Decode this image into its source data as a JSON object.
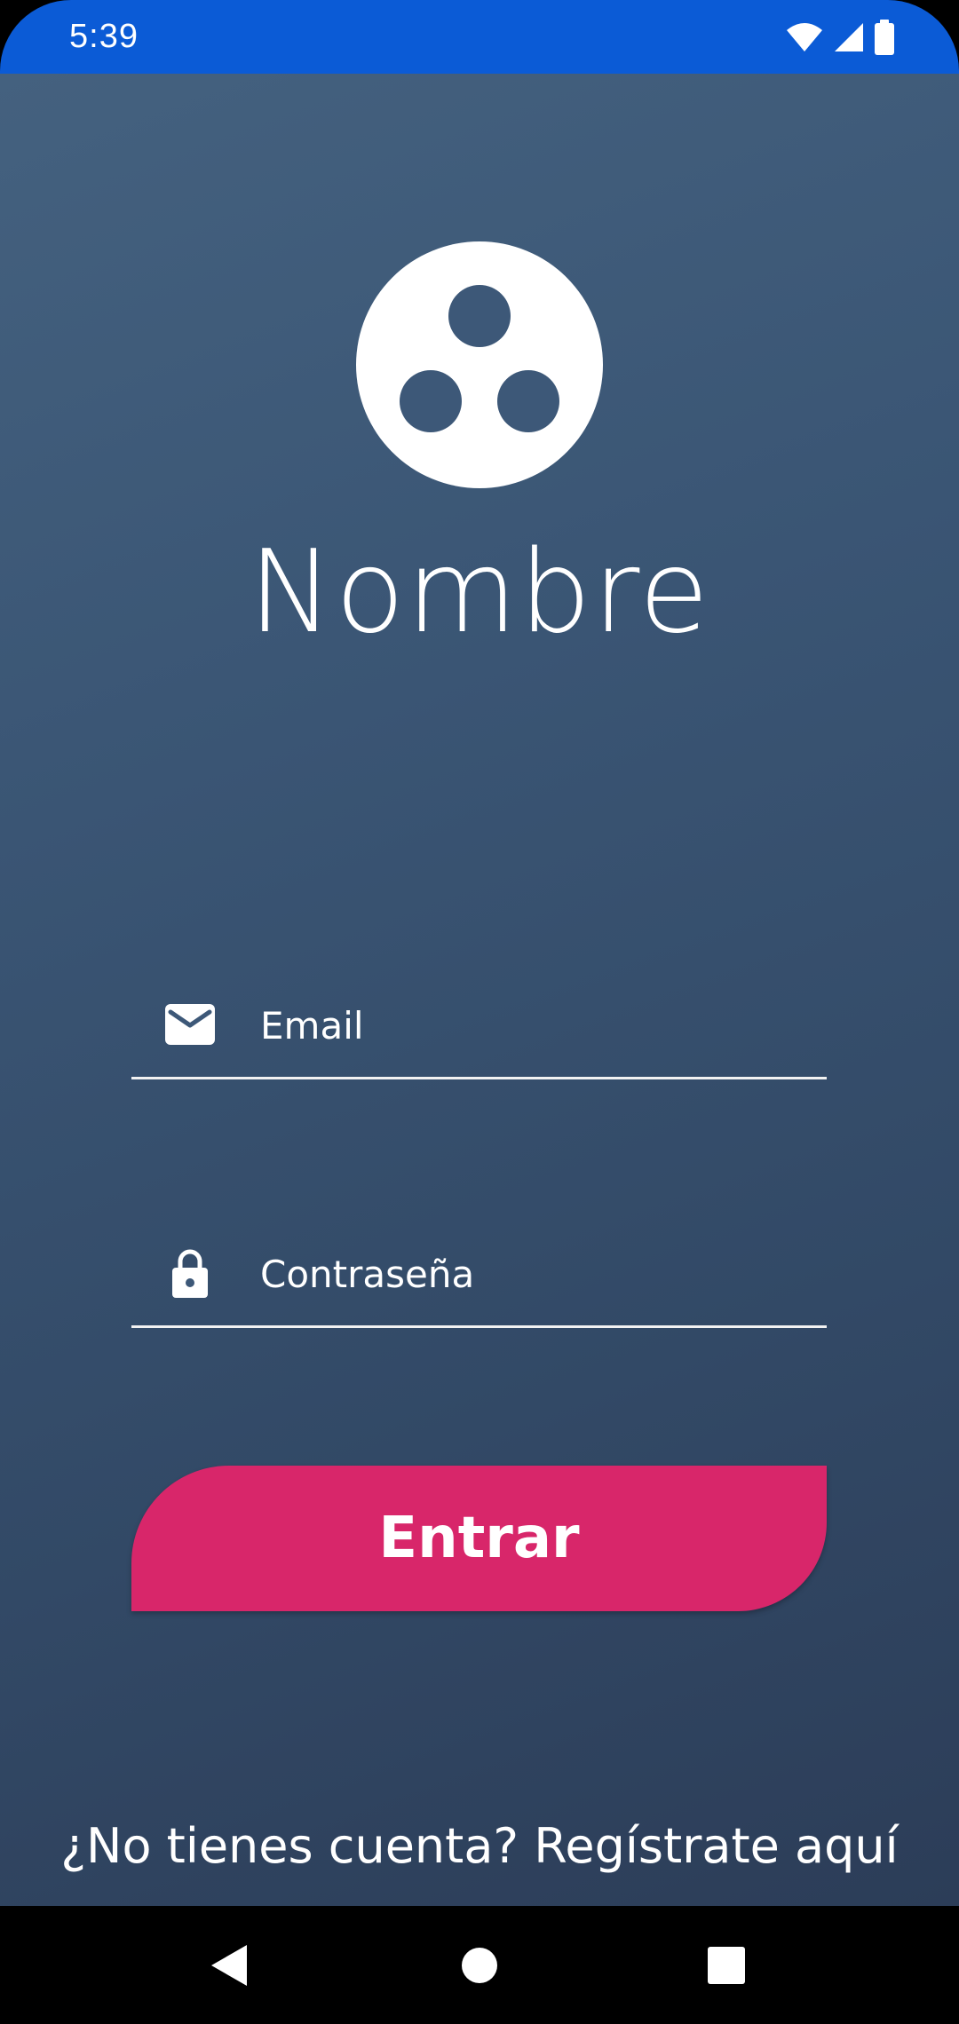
{
  "status_bar": {
    "time": "5:39",
    "icons": [
      "wifi-icon",
      "signal-icon",
      "battery-icon"
    ],
    "color": "#0b5bd6"
  },
  "app": {
    "logo_icon": "three-dots-circle-logo",
    "name": "Nombre"
  },
  "form": {
    "email": {
      "icon": "mail-icon",
      "placeholder": "Email",
      "value": ""
    },
    "password": {
      "icon": "lock-icon",
      "placeholder": "Contraseña",
      "value": ""
    },
    "submit_label": "Entrar",
    "submit_color": "#d8266a"
  },
  "register_text": "¿No tienes cuenta? Regístrate aquí",
  "nav_bar": {
    "buttons": [
      "back-icon",
      "home-icon",
      "recents-icon"
    ]
  }
}
